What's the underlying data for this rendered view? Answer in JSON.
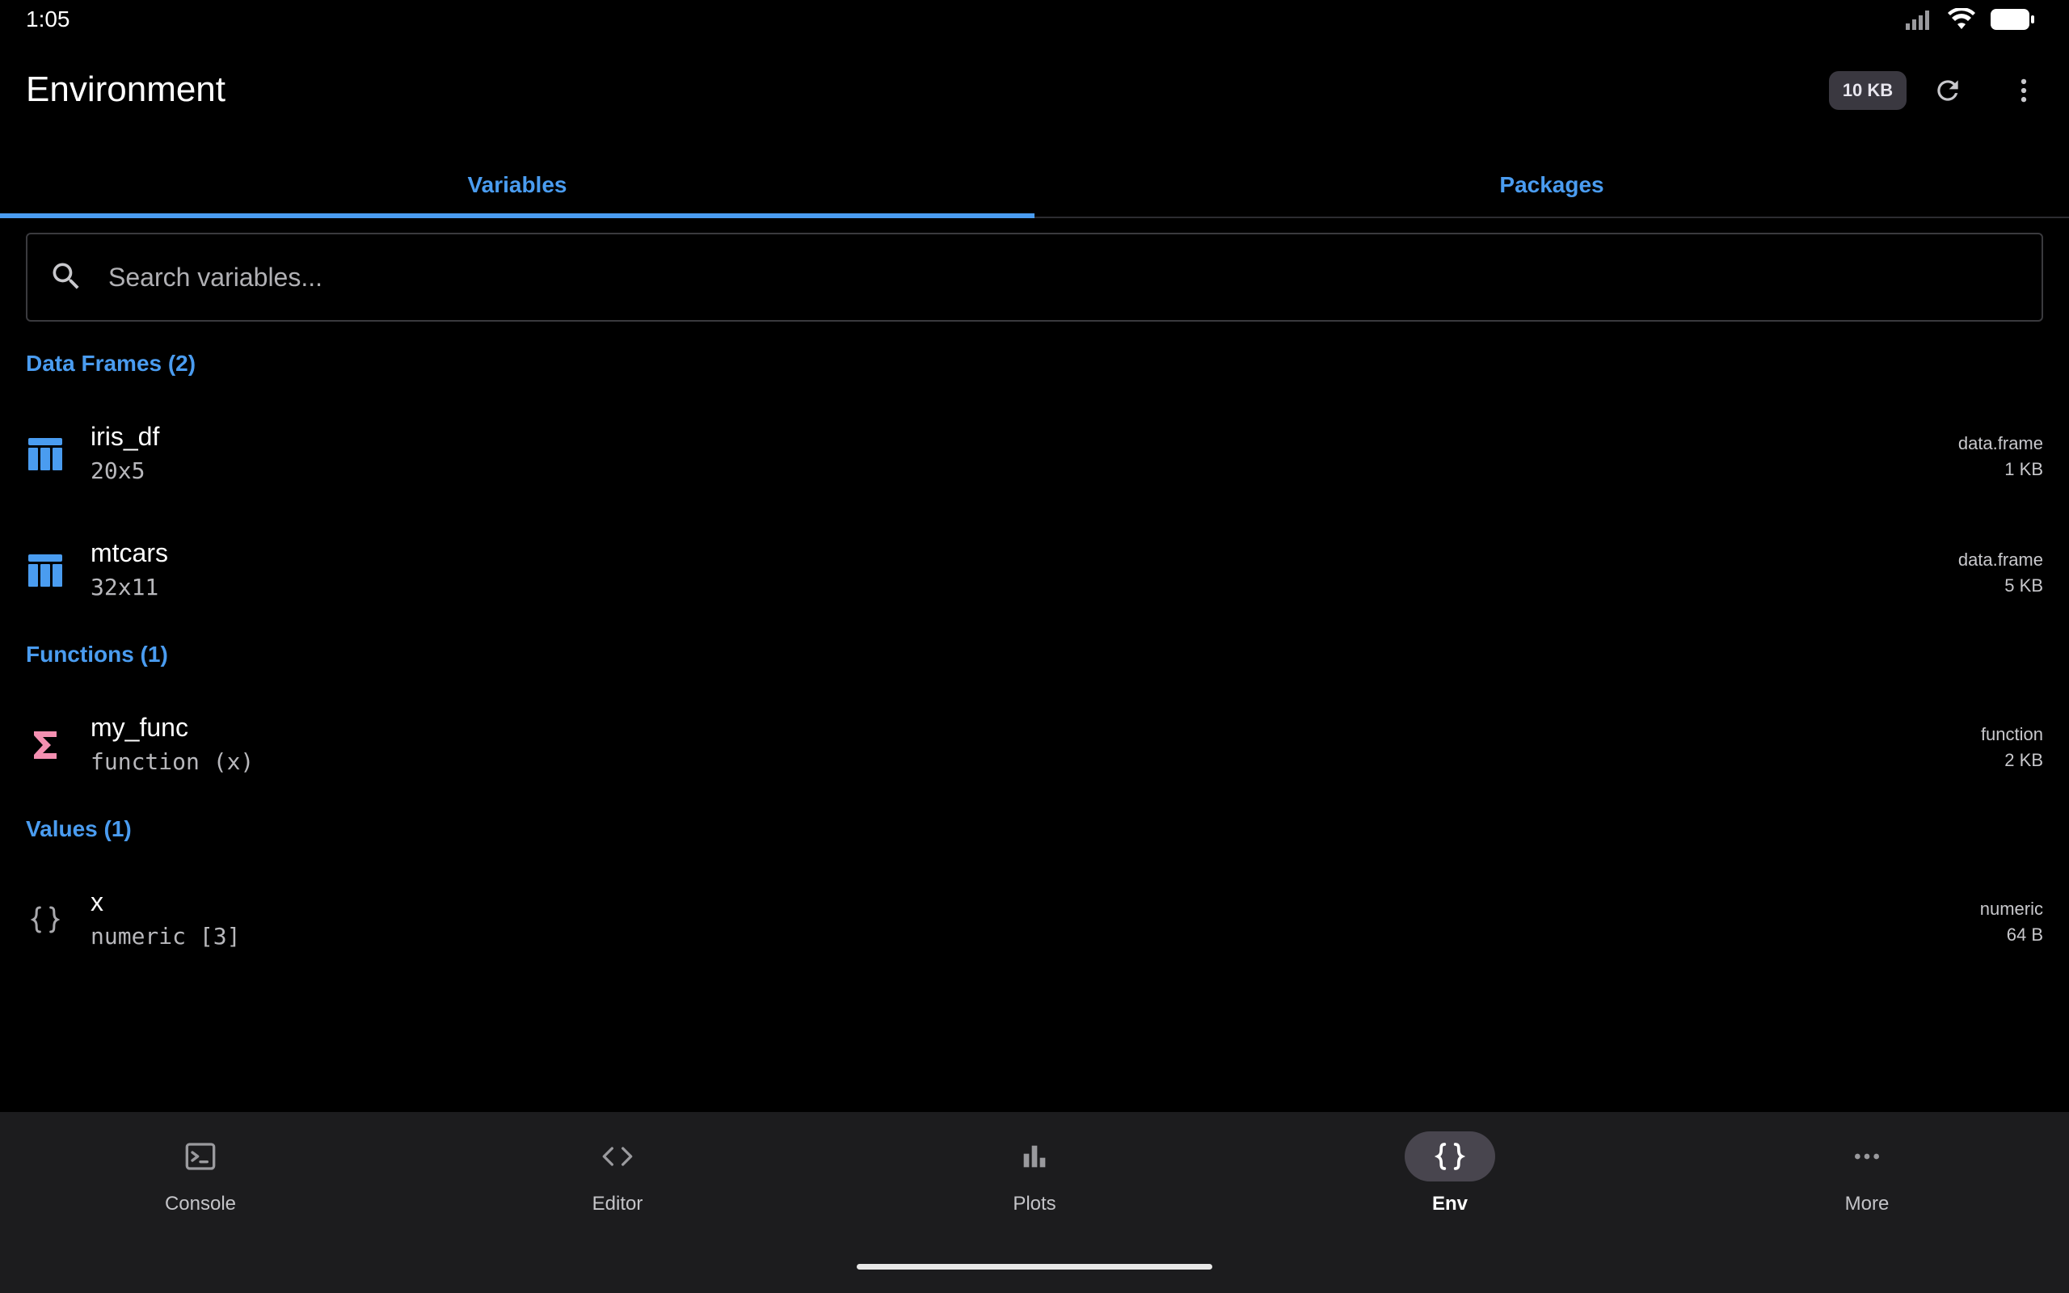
{
  "status_bar": {
    "time": "1:05"
  },
  "header": {
    "title": "Environment",
    "memory_chip": "10 KB"
  },
  "tabs": [
    {
      "label": "Variables",
      "active": true
    },
    {
      "label": "Packages",
      "active": false
    }
  ],
  "search": {
    "placeholder": "Search variables..."
  },
  "sections": [
    {
      "title": "Data Frames (2)",
      "items": [
        {
          "icon": "table-icon",
          "name": "iris_df",
          "desc": "20x5",
          "type": "data.frame",
          "size": "1 KB"
        },
        {
          "icon": "table-icon",
          "name": "mtcars",
          "desc": "32x11",
          "type": "data.frame",
          "size": "5 KB"
        }
      ]
    },
    {
      "title": "Functions (1)",
      "items": [
        {
          "icon": "sigma-icon",
          "name": "my_func",
          "desc": "function (x)",
          "type": "function",
          "size": "2 KB"
        }
      ]
    },
    {
      "title": "Values (1)",
      "items": [
        {
          "icon": "braces-icon",
          "name": "x",
          "desc": "numeric [3]",
          "type": "numeric",
          "size": "64 B"
        }
      ]
    }
  ],
  "bottom_nav": [
    {
      "label": "Console",
      "icon": "terminal-icon",
      "active": false
    },
    {
      "label": "Editor",
      "icon": "code-icon",
      "active": false
    },
    {
      "label": "Plots",
      "icon": "bar-chart-icon",
      "active": false
    },
    {
      "label": "Env",
      "icon": "braces-icon",
      "active": true
    },
    {
      "label": "More",
      "icon": "more-horizontal-icon",
      "active": false
    }
  ],
  "colors": {
    "accent": "#4a9cf0",
    "function_icon": "#f48fb1",
    "background": "#000000",
    "nav_background": "#1c1c1e"
  }
}
